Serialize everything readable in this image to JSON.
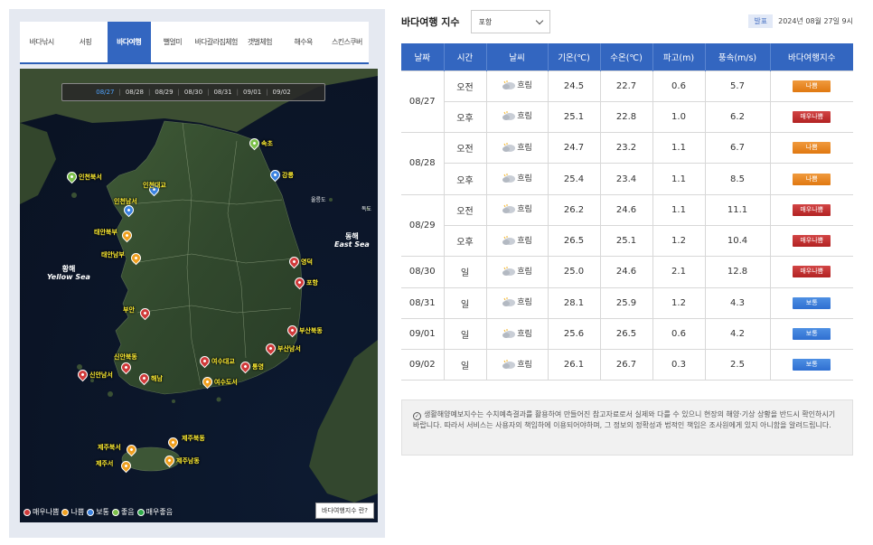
{
  "tabs": [
    {
      "label": "바다낚시",
      "active": false
    },
    {
      "label": "서핑",
      "active": false
    },
    {
      "label": "바다여행",
      "active": true
    },
    {
      "label": "뻘얼미",
      "active": false
    },
    {
      "label": "바다갈라짐체험",
      "active": false
    },
    {
      "label": "갯벌체험",
      "active": false
    },
    {
      "label": "해수욕",
      "active": false
    },
    {
      "label": "스킨스쿠버",
      "active": false
    }
  ],
  "map": {
    "dates": [
      "08/27",
      "08/28",
      "08/29",
      "08/30",
      "08/31",
      "09/01",
      "09/02"
    ],
    "active_date": "08/27",
    "seas": {
      "west_ko": "황해",
      "west_en": "Yellow Sea",
      "east_ko": "동해",
      "east_en": "East Sea"
    },
    "islands": {
      "ulleung": "울릉도",
      "dokdo": "독도"
    },
    "stations": [
      {
        "name": "속초",
        "status": "매우좋음"
      },
      {
        "name": "강릉",
        "status": "보통"
      },
      {
        "name": "인천북서",
        "status": "좋음"
      },
      {
        "name": "인천대교",
        "status": "보통"
      },
      {
        "name": "인천남서",
        "status": "보통"
      },
      {
        "name": "태안북부",
        "status": "나쁨"
      },
      {
        "name": "태안남부",
        "status": "나쁨"
      },
      {
        "name": "영덕",
        "status": "매우나쁨"
      },
      {
        "name": "포항",
        "status": "매우나쁨"
      },
      {
        "name": "부안",
        "status": "매우나쁨"
      },
      {
        "name": "부산북동",
        "status": "매우나쁨"
      },
      {
        "name": "부산남서",
        "status": "매우나쁨"
      },
      {
        "name": "신안북동",
        "status": "매우나쁨"
      },
      {
        "name": "신안남서",
        "status": "매우나쁨"
      },
      {
        "name": "해남",
        "status": "매우나쁨"
      },
      {
        "name": "여수대교",
        "status": "매우나쁨"
      },
      {
        "name": "통영",
        "status": "매우나쁨"
      },
      {
        "name": "여수도서",
        "status": "나쁨"
      },
      {
        "name": "제주북동",
        "status": "나쁨"
      },
      {
        "name": "제주북서",
        "status": "나쁨"
      },
      {
        "name": "제주서",
        "status": "나쁨"
      },
      {
        "name": "제주남동",
        "status": "나쁨"
      }
    ],
    "legend": [
      {
        "label": "매우나쁨",
        "color": "#d03a3a"
      },
      {
        "label": "나쁨",
        "color": "#f0a020"
      },
      {
        "label": "보통",
        "color": "#3b82e0"
      },
      {
        "label": "좋음",
        "color": "#7cc04a"
      },
      {
        "label": "매우좋음",
        "color": "#2faa4a"
      }
    ],
    "help_label": "바다여행지수 란?"
  },
  "panel": {
    "title": "바다여행 지수",
    "region": "포항",
    "publish_badge": "발표",
    "publish_time": "2024년 08월 27일 9시"
  },
  "table": {
    "headers": [
      "날짜",
      "시간",
      "날씨",
      "기온(℃)",
      "수온(℃)",
      "파고(m)",
      "풍속(m/s)",
      "바다여행지수"
    ],
    "days": [
      {
        "date": "08/27",
        "rows": [
          {
            "time": "오전",
            "weather": "흐림",
            "temp": "24.5",
            "water": "22.7",
            "wave": "0.6",
            "wind": "5.7",
            "index": "나쁨",
            "level": "bad"
          },
          {
            "time": "오후",
            "weather": "흐림",
            "temp": "25.1",
            "water": "22.8",
            "wave": "1.0",
            "wind": "6.2",
            "index": "매우나쁨",
            "level": "verybad"
          }
        ]
      },
      {
        "date": "08/28",
        "rows": [
          {
            "time": "오전",
            "weather": "흐림",
            "temp": "24.7",
            "water": "23.2",
            "wave": "1.1",
            "wind": "6.7",
            "index": "나쁨",
            "level": "bad"
          },
          {
            "time": "오후",
            "weather": "흐림",
            "temp": "25.4",
            "water": "23.4",
            "wave": "1.1",
            "wind": "8.5",
            "index": "나쁨",
            "level": "bad"
          }
        ]
      },
      {
        "date": "08/29",
        "rows": [
          {
            "time": "오전",
            "weather": "흐림",
            "temp": "26.2",
            "water": "24.6",
            "wave": "1.1",
            "wind": "11.1",
            "index": "매우나쁨",
            "level": "verybad"
          },
          {
            "time": "오후",
            "weather": "흐림",
            "temp": "26.5",
            "water": "25.1",
            "wave": "1.2",
            "wind": "10.4",
            "index": "매우나쁨",
            "level": "verybad"
          }
        ]
      },
      {
        "date": "08/30",
        "rows": [
          {
            "time": "일",
            "weather": "흐림",
            "temp": "25.0",
            "water": "24.6",
            "wave": "2.1",
            "wind": "12.8",
            "index": "매우나쁨",
            "level": "verybad"
          }
        ]
      },
      {
        "date": "08/31",
        "rows": [
          {
            "time": "일",
            "weather": "흐림",
            "temp": "28.1",
            "water": "25.9",
            "wave": "1.2",
            "wind": "4.3",
            "index": "보통",
            "level": "normal"
          }
        ]
      },
      {
        "date": "09/01",
        "rows": [
          {
            "time": "일",
            "weather": "흐림",
            "temp": "25.6",
            "water": "26.5",
            "wave": "0.6",
            "wind": "4.2",
            "index": "보통",
            "level": "normal"
          }
        ]
      },
      {
        "date": "09/02",
        "rows": [
          {
            "time": "일",
            "weather": "흐림",
            "temp": "26.1",
            "water": "26.7",
            "wave": "0.3",
            "wind": "2.5",
            "index": "보통",
            "level": "normal"
          }
        ]
      }
    ]
  },
  "notice": {
    "text": "생활해양예보지수는 수치예측결과를 활용하여 만들어진 참고자료로서 실제와 다를 수 있으니 현장의 해양·기상 상황을 반드시 확인하시기 바랍니다. 따라서 서비스는 사용자의 책임하에 이용되어야하며, 그 정보의 정확성과 법적인 책임은 조사원에게 있지 아니함을 알려드립니다."
  }
}
